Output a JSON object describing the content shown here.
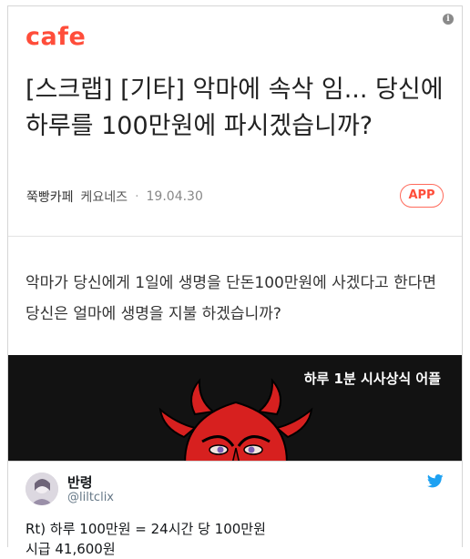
{
  "card": {
    "logo": "cafe",
    "info_icon": "i",
    "title": "[스크랩] [기타] 악마에 속삭 임... 당신에 하루를 100만원에 파시겠습니까?",
    "cafe_name": "쭉빵카페",
    "author": "케요네즈",
    "dot": "·",
    "date": "19.04.30",
    "app_button": "APP",
    "body": "악마가 당신에게 1일에 생명을 단돈100만원에 사겠다고 한다면 당신은 얼마에 생명을 지불 하겠습니까?",
    "banner_caption": "하루 1분 시사상식 어플",
    "colors": {
      "brand": "#ff4d3a",
      "banner_bg": "#121212",
      "devil": "#d7201f"
    }
  },
  "tweet": {
    "name": "반령",
    "handle": "@liltclix",
    "text_line1": "Rt) 하루 100만원 = 24시간 당 100만원",
    "text_line2": "시급 41,600원",
    "icons": {
      "platform": "twitter-bird-icon",
      "avatar": "avatar-icon"
    },
    "colors": {
      "bird": "#1da1f2"
    }
  }
}
